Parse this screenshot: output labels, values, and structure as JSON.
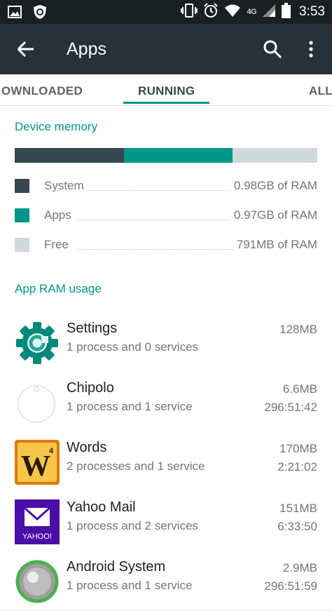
{
  "status_bar": {
    "time": "3:53",
    "network": "4G",
    "icons_left": [
      "gallery-icon",
      "shield-icon"
    ],
    "icons_right": [
      "vibrate-icon",
      "alarm-icon",
      "wifi-icon",
      "signal-icon",
      "battery-icon"
    ]
  },
  "toolbar": {
    "title": "Apps",
    "background": "#263238"
  },
  "tabs": [
    {
      "label": "OWNLOADED",
      "active": false
    },
    {
      "label": "RUNNING",
      "active": true
    },
    {
      "label": "ALL",
      "active": false
    }
  ],
  "device_memory": {
    "heading": "Device memory",
    "bar": [
      {
        "name": "System",
        "fraction": 0.36,
        "color": "#37474f"
      },
      {
        "name": "Apps",
        "fraction": 0.36,
        "color": "#009688"
      },
      {
        "name": "Free",
        "fraction": 0.28,
        "color": "#cfd8dc"
      }
    ],
    "legend": [
      {
        "label": "System",
        "value": "0.98GB of RAM",
        "color": "#37474f"
      },
      {
        "label": "Apps",
        "value": "0.97GB of RAM",
        "color": "#009688"
      },
      {
        "label": "Free",
        "value": "791MB of RAM",
        "color": "#cfd8dc"
      }
    ]
  },
  "app_ram": {
    "heading": "App RAM usage",
    "apps": [
      {
        "name": "Settings",
        "detail": "1 process and 0 services",
        "size": "128MB",
        "time": "",
        "icon": "settings-gear-icon"
      },
      {
        "name": "Chipolo",
        "detail": "1 process and 1 service",
        "size": "6.6MB",
        "time": "296:51:42",
        "icon": "chipolo-icon"
      },
      {
        "name": "Words",
        "detail": "2 processes and 1 service",
        "size": "170MB",
        "time": "2:21:02",
        "icon": "words-tile-icon",
        "tile_letter": "W",
        "tile_score": "4"
      },
      {
        "name": "Yahoo Mail",
        "detail": "1 process and 2 services",
        "size": "151MB",
        "time": "6:33:50",
        "icon": "yahoo-mail-icon",
        "brand": "YAHOO!"
      },
      {
        "name": "Android System",
        "detail": "1 process and 1 service",
        "size": "2.9MB",
        "time": "296:51:59",
        "icon": "android-system-icon"
      }
    ]
  },
  "accent": "#009688"
}
